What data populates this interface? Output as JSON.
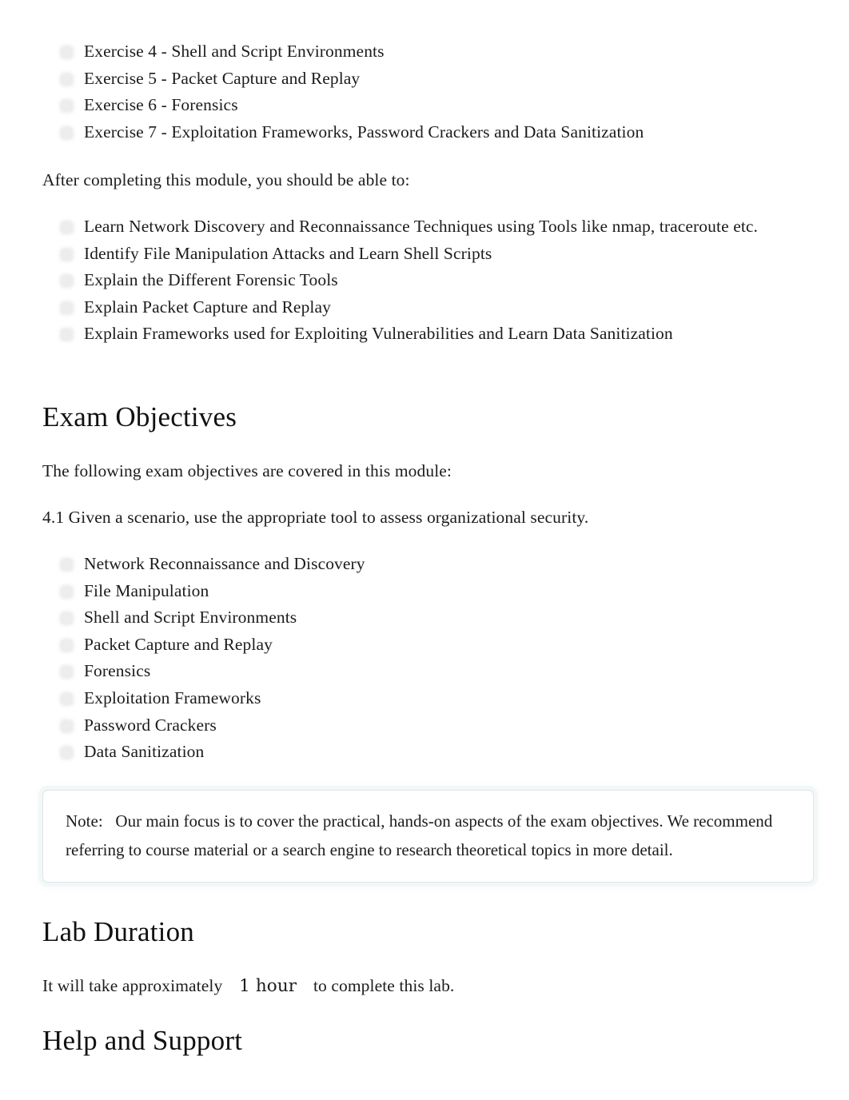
{
  "document": {
    "exercise_list": [
      "Exercise 4 - Shell and Script Environments",
      "Exercise 5 - Packet Capture and Replay",
      "Exercise 6 - Forensics",
      "Exercise 7 - Exploitation Frameworks, Password Crackers and Data Sanitization"
    ],
    "objectives_intro": "After completing this module, you should be able to:",
    "learning_objectives": [
      "Learn Network Discovery and Reconnaissance Techniques using Tools like nmap, traceroute etc.",
      "Identify File Manipulation Attacks and Learn Shell Scripts",
      "Explain the Different Forensic Tools",
      "Explain Packet Capture and Replay",
      "Explain Frameworks used for Exploiting Vulnerabilities and Learn Data Sanitization"
    ],
    "exam_objectives": {
      "heading": "Exam Objectives",
      "intro": "The following exam objectives are covered in this module:",
      "objective_number": "4.1 Given a scenario, use the appropriate tool to assess organizational security.",
      "items": [
        "Network Reconnaissance and Discovery",
        "File Manipulation",
        "Shell and Script Environments",
        "Packet Capture and Replay",
        "Forensics",
        "Exploitation Frameworks",
        "Password Crackers",
        "Data Sanitization"
      ]
    },
    "note": {
      "label": "Note:",
      "text": "Our main focus is to cover the practical, hands-on aspects of the exam objectives. We recommend referring to course material or a search engine to research theoretical topics in more detail."
    },
    "lab_duration": {
      "heading": "Lab Duration",
      "prefix": "It will take approximately",
      "value": "1 hour",
      "suffix": "to complete this lab."
    },
    "help_support": {
      "heading": "Help and Support"
    }
  },
  "colors": {
    "text": "#1c1c1c",
    "heading": "#111111",
    "bullet": "#ededed",
    "note_border": "#dde6e8",
    "note_glow": "#f2f7f7",
    "page_background": "#ffffff"
  }
}
